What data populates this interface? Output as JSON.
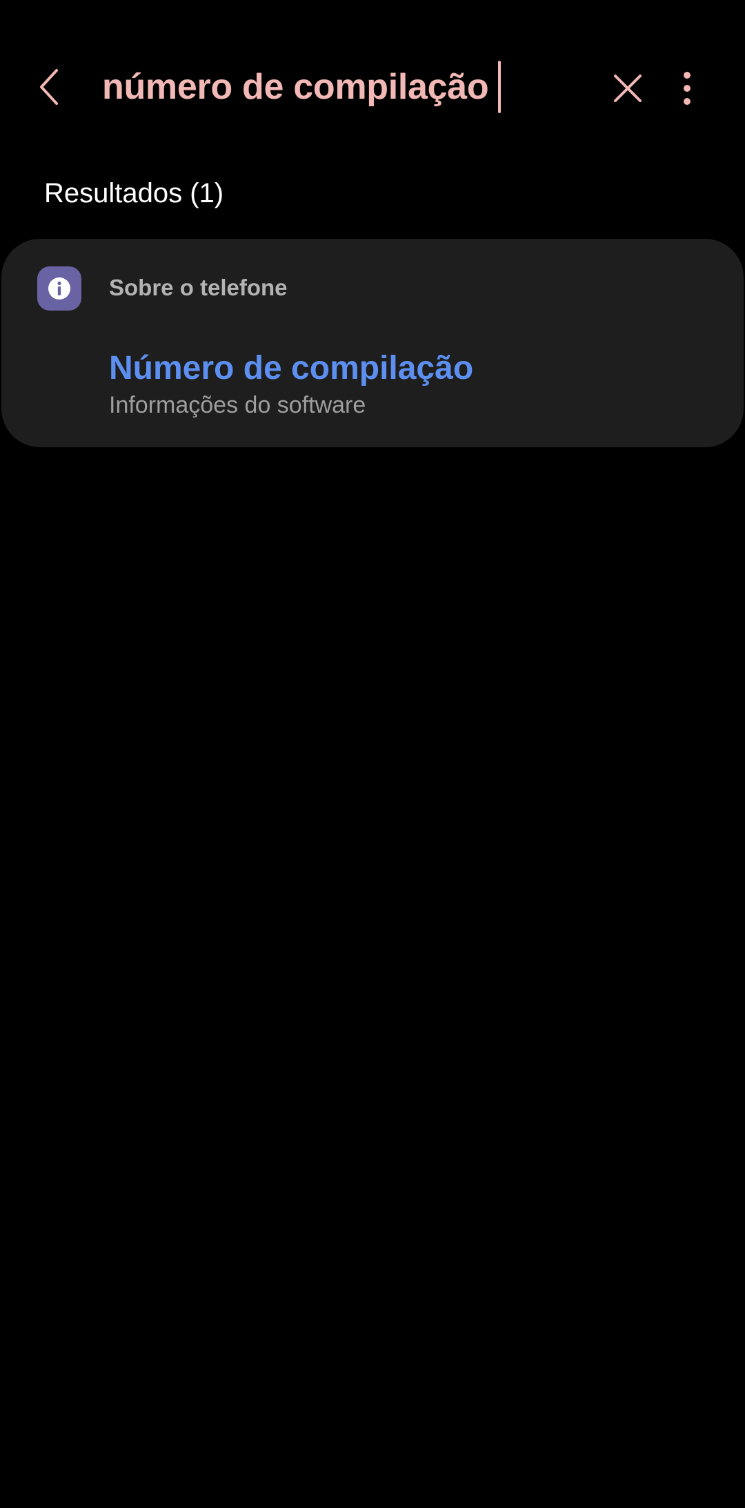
{
  "search": {
    "query": "número de compilação",
    "back_icon": "chevron-left-icon",
    "clear_icon": "close-icon",
    "more_icon": "more-vertical-icon"
  },
  "results": {
    "header": "Resultados (1)",
    "items": [
      {
        "category": "Sobre o telefone",
        "category_icon": "info-icon",
        "title": "Número de compilação",
        "subtitle": "Informações do software"
      }
    ]
  },
  "colors": {
    "background": "#000000",
    "accent_query": "#f2b8b5",
    "card": "#1e1e1e",
    "result_title": "#5c8ff0",
    "category_icon_bg": "#6a63a3"
  }
}
